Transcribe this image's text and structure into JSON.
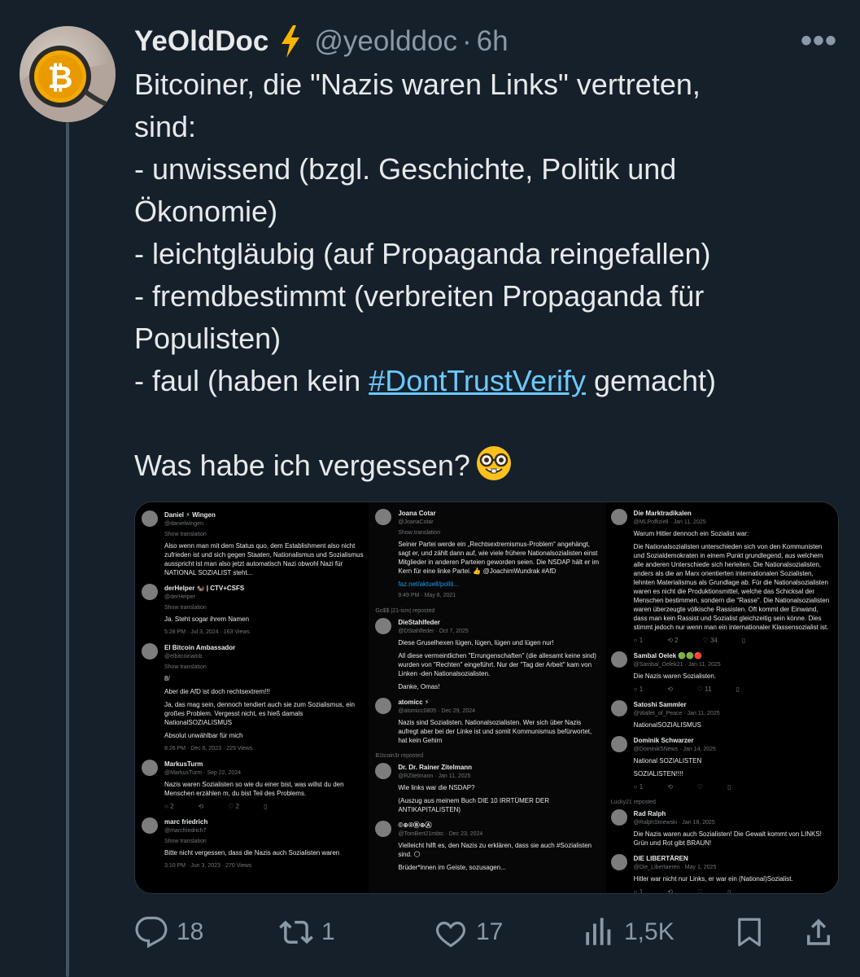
{
  "tweet": {
    "display_name": "YeOldDoc",
    "name_emoji": "lightning-emoji",
    "handle": "@yeolddoc",
    "separator": "·",
    "time": "6h",
    "more_label": "•••",
    "text_lines": [
      "Bitcoiner, die \"Nazis waren Links\" vertreten,",
      "sind:",
      "- unwissend (bzgl. Geschichte, Politik und",
      "Ökonomie)",
      "- leichtgläubig (auf Propaganda reingefallen)",
      "- fremdbestimmt (verbreiten Propaganda für",
      "Populisten)"
    ],
    "line8_prefix": "- faul (haben kein ",
    "hashtag": "#DontTrustVerify",
    "line8_suffix": " gemacht)",
    "line_question": "Was habe ich vergessen?",
    "question_emoji": "nerd-face-emoji"
  },
  "media": {
    "col1": [
      {
        "name": "Daniel ⚡ Wingen",
        "handle": "@danielwingen",
        "trans": "Show translation",
        "body": [
          "Also wenn man mit dem Status quo, dem Establishment also nicht zufrieden ist und sich gegen Staaten, Nationalismus und Sozialismus ausspricht ist man also jetzt automatisch Nazi obwohl Nazi für NATIONAL SOZIALIST steht..."
        ]
      },
      {
        "name": "derHelper 🦦 | CTV+CSFS",
        "handle": "@derHelper",
        "trans": "Show translation",
        "body": [
          "Ja. Steht sogar ihrem Namen"
        ],
        "meta": "5:28 PM · Jul 3, 2024 · 163 Views"
      },
      {
        "name": "El Bitcoin Ambassador",
        "handle": "@elbitcoinamb",
        "trans": "Show translation",
        "body": [
          "8/",
          "Aber die AfD ist doch rechtsextrem!!!",
          "Ja, das mag sein, dennoch tendiert auch sie zum Sozialismus, ein großes Problem. Vergesst nicht, es hieß damals NationalSOZIALISMUS",
          "Absolut unwählbar für mich"
        ],
        "meta": "8:26 PM · Dec 6, 2023 · 229 Views"
      },
      {
        "name": "MarkusTurm",
        "handle": "@MarkusTurm · Sep 22, 2024",
        "body": [
          "Nazis waren Sozialisten so wie du einer bist, was willst du den Menschen erzählen m, du bist Teil des Problems."
        ],
        "icons": [
          "2",
          "",
          "2",
          ""
        ]
      },
      {
        "name": "marc friedrich",
        "handle": "@marcfriedrich7",
        "trans": "Show translation",
        "body": [
          "Bitte nicht vergessen, dass die Nazis auch Sozialisten waren"
        ],
        "meta": "3:10 PM · Jun 3, 2023 · 270 Views"
      }
    ],
    "col2": [
      {
        "name": "Joana Cotar",
        "handle": "@JoanaCotar",
        "trans": "Show translation",
        "body": [
          "Seiner Partei werde ein „Rechtsextremismus-Problem“ angehängt, sagt er, und zählt dann auf, wie viele frühere Nationalsozialisten einst Mitglieder in anderen Parteien geworden seien. Die NSDAP hält er im Kern für eine linke Partei. 👍 @JoachimWundrak #AfD"
        ],
        "link": "faz.net/aktuell/politi...",
        "meta": "9:49 PM · May 8, 2021"
      },
      {
        "repost": "Go$$ |21-ism| reposted",
        "name": "DieStahlfeder",
        "handle": "@DStahlfeder · Oct 7, 2025",
        "body": [
          "Diese Gruselhexen lügen, lügen, lügen und lügen nur!",
          "All diese vermeintlichen \"Errungenschaften\" (die allesamt keine sind) wurden von \"Rechten\" eingeführt. Nur der \"Tag der Arbeit\" kam von Linken -den Nationalsozialisten.",
          "Danke, Omas!"
        ]
      },
      {
        "name": "atomicc ⚡",
        "handle": "@atomicc0805 · Dec 29, 2024",
        "body": [
          "Nazis sind Sozialisten. Nationalsozialisten. Wer sich über Nazis aufregt aber bei der Linke ist und somit Kommunismus befürwortet, hat kein Gehirn"
        ]
      },
      {
        "repost": "B1tcoin3r reposted",
        "name": "Dr. Dr. Rainer Zitelmann",
        "handle": "@RZitelmann · Jan 11, 2025",
        "body": [
          "Wie links war die NSDAP?",
          "(Auszug aus meinem Buch DIE 10 IRRTÜMER DER ANTIKAPITALISTEN)"
        ]
      },
      {
        "name": "©⊕®Ⓑ⊕Ⓐ",
        "handle": "@TomBert21mbtc · Dec 23, 2024",
        "body": [
          "Vielleicht hilft es, den Nazis zu erklären, dass sie auch #Sozialisten sind. 🌕",
          "Brüder*innen im Geiste, sozusagen..."
        ]
      }
    ],
    "col3": [
      {
        "name": "Die Marktradikalen",
        "handle": "@MLPoffiziell · Jan 11, 2025",
        "body": [
          "Warum Hitler dennoch ein Sozialist war:",
          "Die Nationalsozialisten unterschieden sich von den Kommunisten und Sozialdemokraten in einem Punkt grundlegend, aus welchem alle anderen Unterschiede sich herleiten. Die Nationalsozialisten, anders als die an Marx orientierten internationalen Sozialisten, lehnten Materialismus als Grundlage ab. Für die Nationalsozialisten waren es nicht die Produktionsmittel, welche das Schicksal der Menschen bestimmen, sondern die \"Rasse\". Die Nationalsozialisten waren überzeugte völkische Rassisten. Oft kommt der Einwand, dass man kein Rassist und Sozialist gleichzeitig sein könne. Dies stimmt jedoch nur wenn man ein internationaler Klassensozialist ist."
        ],
        "icons": [
          "1",
          "2",
          "34",
          ""
        ]
      },
      {
        "name": "Sambal Oelek 🟢🟢🔴",
        "handle": "@Sambal_Oelek21 · Jan 11, 2025",
        "body": [
          "Die Nazis waren Sozialisten."
        ],
        "icons": [
          "1",
          "",
          "11",
          ""
        ]
      },
      {
        "name": "Satoshi Sammler",
        "handle": "@Wallet_of_Peace · Jan 11, 2025",
        "body": [
          "NationalSOZIALISMUS"
        ]
      },
      {
        "name": "Dominik Schwarzer",
        "handle": "@DominikSNews · Jan 14, 2025",
        "body": [
          "National SOZIALISTEN",
          "SOZIALISTEN!!!!"
        ],
        "icons": [
          "1",
          "",
          "",
          ""
        ]
      },
      {
        "repost": "Lucky21 reposted",
        "name": "Rad Ralph",
        "handle": "@RalphStriewski · Jan 18, 2025",
        "body": [
          "Die Nazis waren auch Sozialisten! Die Gewalt kommt von LINKS! Grün und Rot gibt BRAUN!"
        ]
      },
      {
        "name": "DIE LIBERTÄREN",
        "handle": "@Die_Libertaeren · May 1, 2025",
        "body": [
          "Hitler war nicht nur Links, er war ein (National)Sozialist."
        ],
        "icons": [
          "1",
          "",
          "",
          ""
        ]
      }
    ]
  },
  "actions": {
    "reply_count": "18",
    "retweet_count": "1",
    "like_count": "17",
    "views_count": "1,5K"
  },
  "colors": {
    "background": "#15202b",
    "text": "#e7e9ea",
    "muted": "#8b98a5",
    "link": "#6bc9fb"
  }
}
